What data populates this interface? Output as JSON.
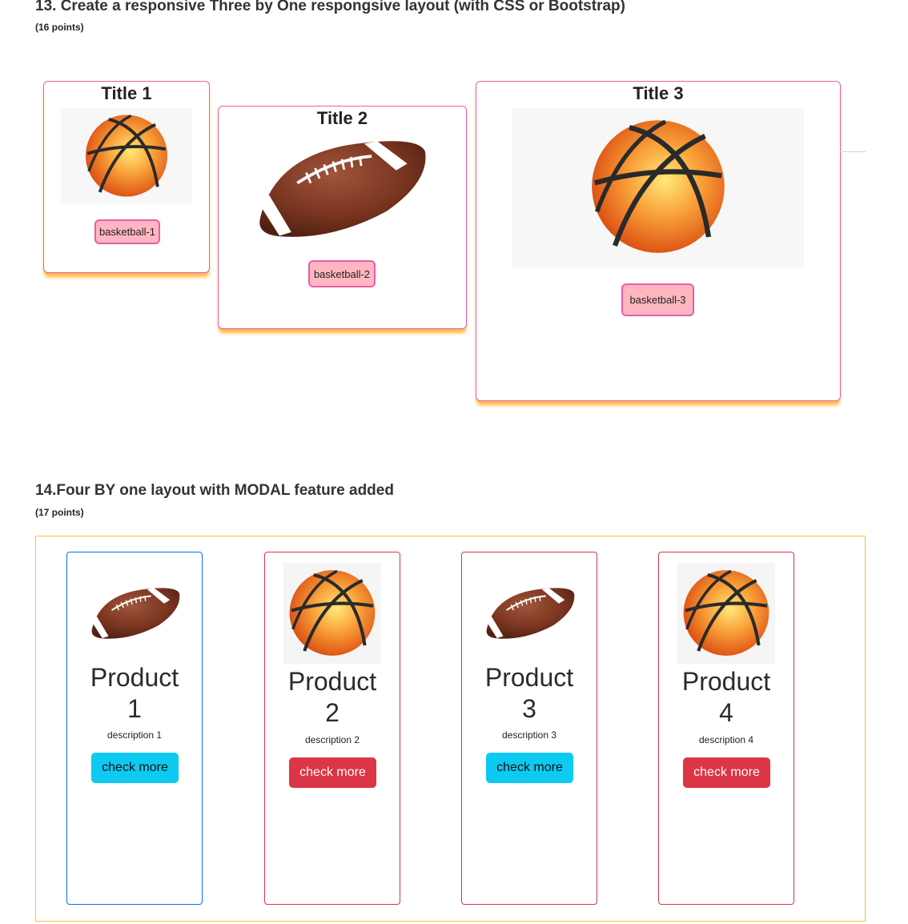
{
  "section13": {
    "heading": "13. Create a responsive Three by One respongsive layout (with CSS or Bootstrap)",
    "points": "(16 points)",
    "cards": [
      {
        "title": "Title 1",
        "button": "basketball-1",
        "image": "basketball-icon"
      },
      {
        "title": "Title 2",
        "button": "basketball-2",
        "image": "football-icon"
      },
      {
        "title": "Title 3",
        "button": "basketball-3",
        "image": "basketball-icon"
      }
    ]
  },
  "section14": {
    "heading": "14.Four BY one layout with MODAL feature added",
    "points": "(17 points)",
    "products": [
      {
        "title_line1": "Product",
        "title_line2": "1",
        "description": "description 1",
        "button": "check more",
        "image": "football-icon",
        "button_color": "#0dcaf0"
      },
      {
        "title_line1": "Product",
        "title_line2": "2",
        "description": "description 2",
        "button": "check more",
        "image": "basketball-icon",
        "button_color": "#dc3545"
      },
      {
        "title_line1": "Product",
        "title_line2": "3",
        "description": "description 3",
        "button": "check more",
        "image": "football-icon",
        "button_color": "#0dcaf0"
      },
      {
        "title_line1": "Product",
        "title_line2": "4",
        "description": "description 4",
        "button": "check more",
        "image": "basketball-icon",
        "button_color": "#dc3545"
      }
    ]
  },
  "colors": {
    "card_border_pink": "#e85da8",
    "pill_bg": "#ffb6c1",
    "card_shadow_orange": "#ffa000",
    "wrapper_border": "#f0c43a",
    "product_border_red": "#dc3545",
    "product_border_blue": "#0d6efd"
  }
}
